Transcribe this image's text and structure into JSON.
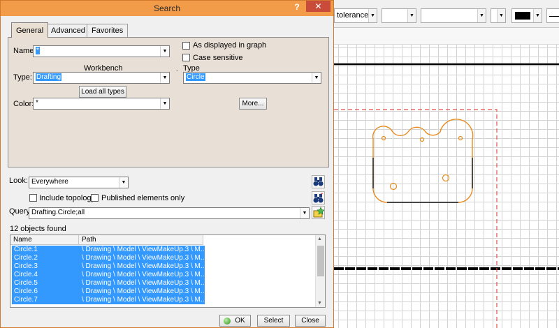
{
  "dialog": {
    "title": "Search",
    "help_glyph": "?",
    "close_glyph": "✕",
    "tabs": [
      {
        "label": "General",
        "active": true
      },
      {
        "label": "Advanced",
        "active": false
      },
      {
        "label": "Favorites",
        "active": false
      }
    ],
    "general": {
      "name_label": "Name:",
      "name_value": "*",
      "as_displayed_label": "As displayed in graph",
      "case_sensitive_label": "Case sensitive",
      "workbench_label": "Workbench",
      "type_label": "Type:",
      "type_header_label": "Type",
      "workbench_value": "Drafting",
      "type_value": "Circle",
      "load_all_types_label": "Load all types",
      "color_label": "Color:",
      "color_value": "*",
      "more_label": "More..."
    },
    "look_label": "Look:",
    "look_value": "Everywhere",
    "include_topology_label": "Include topology",
    "published_only_label": "Published elements only",
    "query_label": "Query:",
    "query_value": "Drafting.Circle;all",
    "found_text": "12 objects found",
    "columns": [
      "Name",
      "Path"
    ],
    "rows": [
      {
        "name": "Circle.1",
        "path": "\\ Drawing \\ Model \\ ViewMakeUp.3 \\ M..."
      },
      {
        "name": "Circle.2",
        "path": "\\ Drawing \\ Model \\ ViewMakeUp.3 \\ M..."
      },
      {
        "name": "Circle.3",
        "path": "\\ Drawing \\ Model \\ ViewMakeUp.3 \\ M..."
      },
      {
        "name": "Circle.4",
        "path": "\\ Drawing \\ Model \\ ViewMakeUp.3 \\ M..."
      },
      {
        "name": "Circle.5",
        "path": "\\ Drawing \\ Model \\ ViewMakeUp.3 \\ M..."
      },
      {
        "name": "Circle.6",
        "path": "\\ Drawing \\ Model \\ ViewMakeUp.3 \\ M..."
      },
      {
        "name": "Circle.7",
        "path": "\\ Drawing \\ Model \\ ViewMakeUp.3 \\ M..."
      }
    ],
    "buttons": {
      "ok": "OK",
      "select": "Select",
      "close": "Close"
    }
  },
  "background_toolbar": {
    "combo1": "tolerance)"
  },
  "colors": {
    "titlebar": "#f29b49",
    "selection": "#3399ff",
    "geometry_orange": "#e88a1c",
    "frame_red_dashed": "#e0504a"
  }
}
